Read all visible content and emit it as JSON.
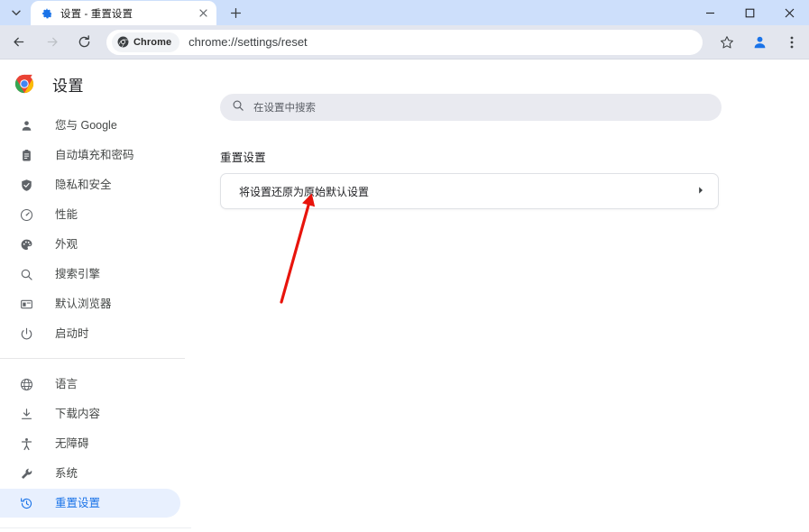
{
  "window": {
    "controls": [
      {
        "name": "minimize",
        "glyph": "minimize-icon"
      },
      {
        "name": "maximize",
        "glyph": "maximize-icon"
      },
      {
        "name": "close",
        "glyph": "close-icon"
      }
    ]
  },
  "tabstrip": {
    "tab_search_icon": "chevron-down-icon",
    "new_tab_icon": "plus-icon",
    "tabs": [
      {
        "title": "设置 - 重置设置",
        "favicon": "settings-gear-icon",
        "active": true,
        "close_icon": "close-icon"
      }
    ]
  },
  "toolbar": {
    "back_icon": "back-arrow-icon",
    "forward_icon": "forward-arrow-icon",
    "reload_icon": "reload-icon",
    "omnibox": {
      "pill_icon": "chrome-logo-icon",
      "pill_label": "Chrome",
      "url": "chrome://settings/reset"
    },
    "bookmark_icon": "star-icon",
    "profile_icon": "profile-avatar-icon",
    "menu_icon": "three-dot-menu-icon"
  },
  "sidebar": {
    "brand": {
      "logo": "chrome-logo-icon",
      "title": "设置"
    },
    "groups": [
      {
        "items": [
          {
            "label": "您与 Google",
            "icon": "person-icon",
            "selected": false
          },
          {
            "label": "自动填充和密码",
            "icon": "clipboard-icon",
            "selected": false
          },
          {
            "label": "隐私和安全",
            "icon": "shield-icon",
            "selected": false
          },
          {
            "label": "性能",
            "icon": "speedometer-icon",
            "selected": false
          },
          {
            "label": "外观",
            "icon": "palette-icon",
            "selected": false
          },
          {
            "label": "搜索引擎",
            "icon": "search-icon",
            "selected": false
          },
          {
            "label": "默认浏览器",
            "icon": "browser-window-icon",
            "selected": false
          },
          {
            "label": "启动时",
            "icon": "power-icon",
            "selected": false
          }
        ]
      },
      {
        "items": [
          {
            "label": "语言",
            "icon": "globe-icon",
            "selected": false
          },
          {
            "label": "下载内容",
            "icon": "download-icon",
            "selected": false
          },
          {
            "label": "无障碍",
            "icon": "accessibility-icon",
            "selected": false
          },
          {
            "label": "系统",
            "icon": "wrench-icon",
            "selected": false
          },
          {
            "label": "重置设置",
            "icon": "history-restore-icon",
            "selected": true
          }
        ]
      }
    ]
  },
  "main": {
    "search": {
      "icon": "search-icon",
      "placeholder": "在设置中搜索",
      "value": ""
    },
    "section_title": "重置设置",
    "rows": [
      {
        "label": "将设置还原为原始默认设置",
        "chevron": "chevron-right-icon"
      }
    ]
  },
  "annotation": {
    "arrow_color": "#e8140c",
    "target": "reset-settings-row"
  },
  "colors": {
    "tabstrip_bg": "#cddffb",
    "toolbar_bg": "#e3e6ee",
    "page_bg": "#ffffff",
    "accent_blue": "#1a73e8",
    "selected_pill_bg": "#e8f0fe",
    "search_bg": "#e9eaf0",
    "arrow_red": "#e8140c"
  }
}
